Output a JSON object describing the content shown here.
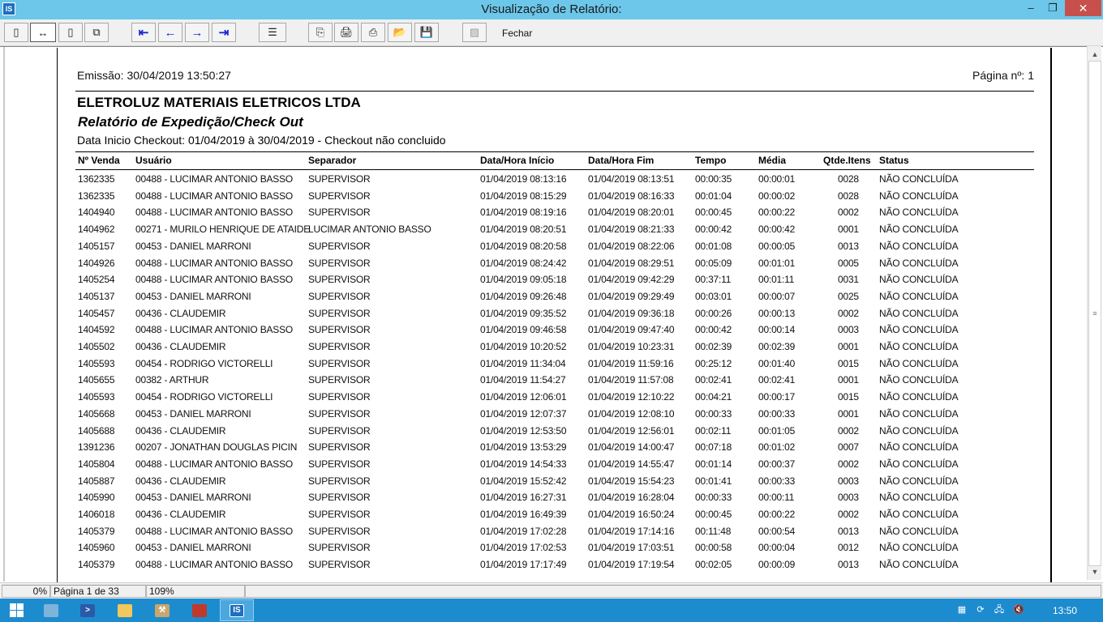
{
  "window": {
    "title": "Visualização de Relatório:",
    "app_icon": "IS",
    "minimize_glyph": "–",
    "maximize_glyph": "❐",
    "close_glyph": "✕"
  },
  "toolbar": {
    "buttons": [
      {
        "icon": "single-page-icon",
        "glyph": "▯"
      },
      {
        "icon": "fit-width-icon",
        "glyph": "↔"
      },
      {
        "icon": "full-page-icon",
        "glyph": "▯"
      },
      {
        "icon": "multi-page-icon",
        "glyph": "⧉"
      },
      {
        "icon": "first-page-icon",
        "glyph": "⇤"
      },
      {
        "icon": "previous-page-icon",
        "glyph": "←"
      },
      {
        "icon": "next-page-icon",
        "glyph": "→"
      },
      {
        "icon": "last-page-icon",
        "glyph": "⇥"
      },
      {
        "icon": "goto-page-icon",
        "glyph": "☰"
      },
      {
        "icon": "copy-page-icon",
        "glyph": "⎘"
      },
      {
        "icon": "print-setup-icon",
        "glyph": "🖨"
      },
      {
        "icon": "print-icon",
        "glyph": "⎙"
      },
      {
        "icon": "open-file-icon",
        "glyph": "📂"
      },
      {
        "icon": "save-icon",
        "glyph": "💾"
      },
      {
        "icon": "disabled-tool-icon",
        "glyph": "▨"
      }
    ],
    "close_label": "Fechar"
  },
  "report": {
    "emissao": "Emissão: 30/04/2019 13:50:27",
    "pagina": "Página nº: 1",
    "company": "ELETROLUZ MATERIAIS ELETRICOS LTDA",
    "title": "Relatório de Expedição/Check Out",
    "filter": "Data Inicio Checkout: 01/04/2019 à 30/04/2019 - Checkout não concluido",
    "columns": {
      "venda": "Nº Venda",
      "usuario": "Usuário",
      "separador": "Separador",
      "inicio": "Data/Hora Início",
      "fim": "Data/Hora Fim",
      "tempo": "Tempo",
      "media": "Média",
      "qtde": "Qtde.Itens",
      "status": "Status"
    },
    "rows": [
      [
        "1362335",
        "00488 - LUCIMAR ANTONIO BASSO",
        "SUPERVISOR",
        "01/04/2019 08:13:16",
        "01/04/2019 08:13:51",
        "00:00:35",
        "00:00:01",
        "0028",
        "NÃO CONCLUÍDA"
      ],
      [
        "1362335",
        "00488 - LUCIMAR ANTONIO BASSO",
        "SUPERVISOR",
        "01/04/2019 08:15:29",
        "01/04/2019 08:16:33",
        "00:01:04",
        "00:00:02",
        "0028",
        "NÃO CONCLUÍDA"
      ],
      [
        "1404940",
        "00488 - LUCIMAR ANTONIO BASSO",
        "SUPERVISOR",
        "01/04/2019 08:19:16",
        "01/04/2019 08:20:01",
        "00:00:45",
        "00:00:22",
        "0002",
        "NÃO CONCLUÍDA"
      ],
      [
        "1404962",
        "00271 - MURILO HENRIQUE DE ATAIDE",
        "LUCIMAR ANTONIO BASSO",
        "01/04/2019 08:20:51",
        "01/04/2019 08:21:33",
        "00:00:42",
        "00:00:42",
        "0001",
        "NÃO CONCLUÍDA"
      ],
      [
        "1405157",
        "00453 - DANIEL MARRONI",
        "SUPERVISOR",
        "01/04/2019 08:20:58",
        "01/04/2019 08:22:06",
        "00:01:08",
        "00:00:05",
        "0013",
        "NÃO CONCLUÍDA"
      ],
      [
        "1404926",
        "00488 - LUCIMAR ANTONIO BASSO",
        "SUPERVISOR",
        "01/04/2019 08:24:42",
        "01/04/2019 08:29:51",
        "00:05:09",
        "00:01:01",
        "0005",
        "NÃO CONCLUÍDA"
      ],
      [
        "1405254",
        "00488 - LUCIMAR ANTONIO BASSO",
        "SUPERVISOR",
        "01/04/2019 09:05:18",
        "01/04/2019 09:42:29",
        "00:37:11",
        "00:01:11",
        "0031",
        "NÃO CONCLUÍDA"
      ],
      [
        "1405137",
        "00453 - DANIEL MARRONI",
        "SUPERVISOR",
        "01/04/2019 09:26:48",
        "01/04/2019 09:29:49",
        "00:03:01",
        "00:00:07",
        "0025",
        "NÃO CONCLUÍDA"
      ],
      [
        "1405457",
        "00436 - CLAUDEMIR",
        "SUPERVISOR",
        "01/04/2019 09:35:52",
        "01/04/2019 09:36:18",
        "00:00:26",
        "00:00:13",
        "0002",
        "NÃO CONCLUÍDA"
      ],
      [
        "1404592",
        "00488 - LUCIMAR ANTONIO BASSO",
        "SUPERVISOR",
        "01/04/2019 09:46:58",
        "01/04/2019 09:47:40",
        "00:00:42",
        "00:00:14",
        "0003",
        "NÃO CONCLUÍDA"
      ],
      [
        "1405502",
        "00436 - CLAUDEMIR",
        "SUPERVISOR",
        "01/04/2019 10:20:52",
        "01/04/2019 10:23:31",
        "00:02:39",
        "00:02:39",
        "0001",
        "NÃO CONCLUÍDA"
      ],
      [
        "1405593",
        "00454 - RODRIGO VICTORELLI",
        "SUPERVISOR",
        "01/04/2019 11:34:04",
        "01/04/2019 11:59:16",
        "00:25:12",
        "00:01:40",
        "0015",
        "NÃO CONCLUÍDA"
      ],
      [
        "1405655",
        "00382 - ARTHUR",
        "SUPERVISOR",
        "01/04/2019 11:54:27",
        "01/04/2019 11:57:08",
        "00:02:41",
        "00:02:41",
        "0001",
        "NÃO CONCLUÍDA"
      ],
      [
        "1405593",
        "00454 - RODRIGO VICTORELLI",
        "SUPERVISOR",
        "01/04/2019 12:06:01",
        "01/04/2019 12:10:22",
        "00:04:21",
        "00:00:17",
        "0015",
        "NÃO CONCLUÍDA"
      ],
      [
        "1405668",
        "00453 - DANIEL MARRONI",
        "SUPERVISOR",
        "01/04/2019 12:07:37",
        "01/04/2019 12:08:10",
        "00:00:33",
        "00:00:33",
        "0001",
        "NÃO CONCLUÍDA"
      ],
      [
        "1405688",
        "00436 - CLAUDEMIR",
        "SUPERVISOR",
        "01/04/2019 12:53:50",
        "01/04/2019 12:56:01",
        "00:02:11",
        "00:01:05",
        "0002",
        "NÃO CONCLUÍDA"
      ],
      [
        "1391236",
        "00207 - JONATHAN DOUGLAS PICIN",
        "SUPERVISOR",
        "01/04/2019 13:53:29",
        "01/04/2019 14:00:47",
        "00:07:18",
        "00:01:02",
        "0007",
        "NÃO CONCLUÍDA"
      ],
      [
        "1405804",
        "00488 - LUCIMAR ANTONIO BASSO",
        "SUPERVISOR",
        "01/04/2019 14:54:33",
        "01/04/2019 14:55:47",
        "00:01:14",
        "00:00:37",
        "0002",
        "NÃO CONCLUÍDA"
      ],
      [
        "1405887",
        "00436 - CLAUDEMIR",
        "SUPERVISOR",
        "01/04/2019 15:52:42",
        "01/04/2019 15:54:23",
        "00:01:41",
        "00:00:33",
        "0003",
        "NÃO CONCLUÍDA"
      ],
      [
        "1405990",
        "00453 - DANIEL MARRONI",
        "SUPERVISOR",
        "01/04/2019 16:27:31",
        "01/04/2019 16:28:04",
        "00:00:33",
        "00:00:11",
        "0003",
        "NÃO CONCLUÍDA"
      ],
      [
        "1406018",
        "00436 - CLAUDEMIR",
        "SUPERVISOR",
        "01/04/2019 16:49:39",
        "01/04/2019 16:50:24",
        "00:00:45",
        "00:00:22",
        "0002",
        "NÃO CONCLUÍDA"
      ],
      [
        "1405379",
        "00488 - LUCIMAR ANTONIO BASSO",
        "SUPERVISOR",
        "01/04/2019 17:02:28",
        "01/04/2019 17:14:16",
        "00:11:48",
        "00:00:54",
        "0013",
        "NÃO CONCLUÍDA"
      ],
      [
        "1405960",
        "00453 - DANIEL MARRONI",
        "SUPERVISOR",
        "01/04/2019 17:02:53",
        "01/04/2019 17:03:51",
        "00:00:58",
        "00:00:04",
        "0012",
        "NÃO CONCLUÍDA"
      ],
      [
        "1405379",
        "00488 - LUCIMAR ANTONIO BASSO",
        "SUPERVISOR",
        "01/04/2019 17:17:49",
        "01/04/2019 17:19:54",
        "00:02:05",
        "00:00:09",
        "0013",
        "NÃO CONCLUÍDA"
      ]
    ]
  },
  "statusbar": {
    "progress": "0%",
    "page": "Página 1 de 33",
    "zoom": "109%"
  },
  "taskbar": {
    "apps": [
      {
        "icon": "server-manager-icon",
        "color": "#7fb3d9"
      },
      {
        "icon": "powershell-icon",
        "color": "#2b5aa8"
      },
      {
        "icon": "file-explorer-icon",
        "color": "#f2c75c"
      },
      {
        "icon": "tools-icon",
        "color": "#c9a66b"
      },
      {
        "icon": "app-launcher-icon",
        "color": "#c0392b"
      },
      {
        "icon": "report-app-icon",
        "color": "#1e6fbf",
        "text": "IS"
      }
    ],
    "clock": "13:50"
  }
}
